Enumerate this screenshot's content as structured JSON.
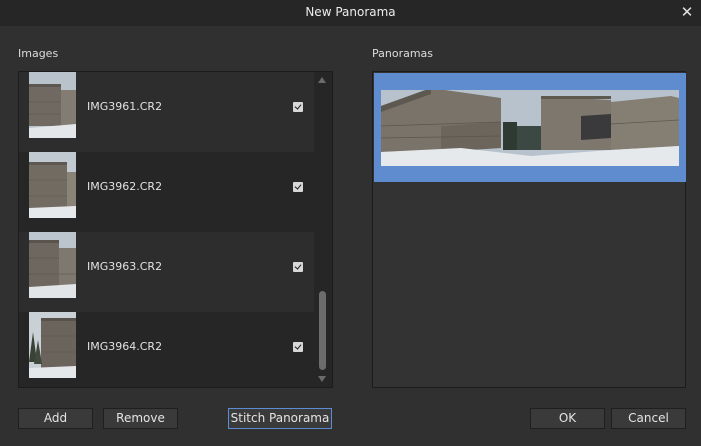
{
  "window": {
    "title": "New Panorama",
    "close_symbol": "✕"
  },
  "images": {
    "label": "Images",
    "items": [
      {
        "name": "IMG3961.CR2",
        "checked": true
      },
      {
        "name": "IMG3962.CR2",
        "checked": true
      },
      {
        "name": "IMG3963.CR2",
        "checked": true
      },
      {
        "name": "IMG3964.CR2",
        "checked": true
      }
    ]
  },
  "panoramas": {
    "label": "Panoramas",
    "selected_color": "#5f8bcf"
  },
  "buttons": {
    "add": "Add",
    "remove": "Remove",
    "stitch": "Stitch Panorama",
    "ok": "OK",
    "cancel": "Cancel"
  },
  "icons": {
    "close": "close-icon",
    "checkbox": "checkmark-icon",
    "scroll_up": "scroll-up-arrow-icon",
    "scroll_down": "scroll-down-arrow-icon"
  }
}
